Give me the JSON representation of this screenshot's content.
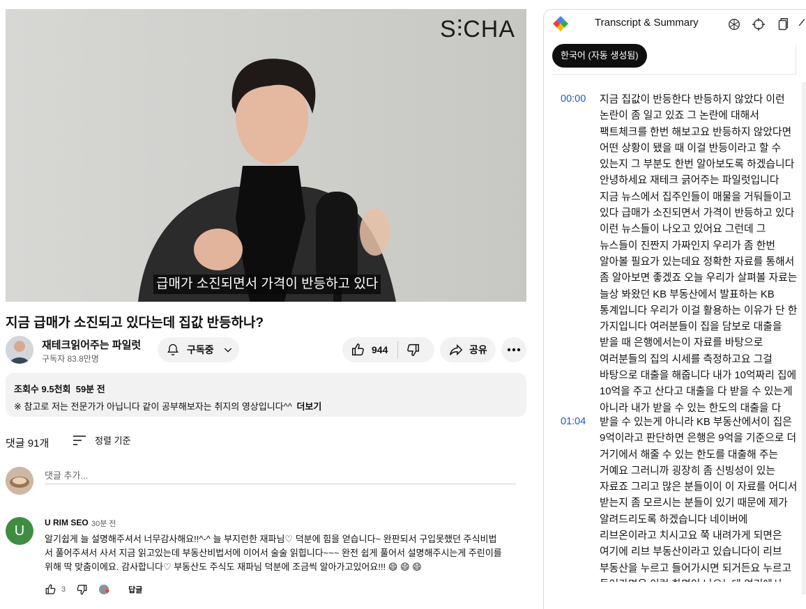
{
  "video": {
    "watermark": "S⫶CHA",
    "caption": "급매가 소진되면서 가격이 반등하고 있다"
  },
  "title": "지금 급매가 소진되고 있다는데 집값 반등하나?",
  "channel": {
    "name": "재테크읽어주는 파일럿",
    "subscribers": "구독자 83.8만명",
    "subscribe_label": "구독중"
  },
  "actions": {
    "likes": "944",
    "share_label": "공유"
  },
  "description": {
    "views": "조회수 9.5천회",
    "age": "59분 전",
    "text": "※ 참고로 저는 전문가가 아닙니다 같이 공부해보자는 취지의 영상입니다^^",
    "more": "더보기"
  },
  "comments": {
    "count_label": "댓글 91개",
    "sort_label": "정렬 기준",
    "add_placeholder": "댓글 추가...",
    "items": [
      {
        "avatar_letter": "U",
        "author": "U RIM SEO",
        "time": "30분 전",
        "text": "알기쉽게 늘 설명해주셔서 너무감사해요!!^-^ 늘 부지런한 재파님♡ 덕분에 힘을 얻습니다~ 완판되서 구입못했던 주식비법서  풀어주셔서 사서 지금 읽고있는데 부동산비법서에 이어서 술술 읽힙니다~~~ 완전 쉽게 풀어서 설명해주시는게 주린이를 위해 딱 맞춤이에요. 감사합니다♡  부동산도 주식도 재파님 덕분에 조금씩 알아가고있어요!!!  😄 😄 😄",
        "likes": "3",
        "reply_label": "답글"
      }
    ]
  },
  "panel": {
    "title": "Transcript & Summary",
    "language_chip": "한국어 (자동 생성됨)",
    "segments": [
      {
        "time": "00:00",
        "text": "지금 집값이 반등한다 반등하지 않았다 이런 논란이 좀 일고 있죠 그 논란에 대해서 팩트체크를 한번 해보고요 반등하지 않았다면 어떤 상황이 됐을 때 이걸 반등이라고 할 수 있는지 그 부분도 한번 알아보도록 하겠습니다 안녕하세요 재테크 긁어주는 파일럿입니다 지금 뉴스에서 집주인들이 매물을 거둬들이고 있다 급매가 소진되면서 가격이 반등하고 있다 이런 뉴스들이 나오고 있어요 그런데 그 뉴스들이 진짠지 가짜인지 우리가 좀 한번 알아볼 필요가 있는데요 정확한 자료를 통해서 좀 알아보면 좋겠죠 오늘 우리가 살펴볼 자료는 늘상 봐왔던 KB 부동산에서 발표하는 KB 통계입니다 우리가 이걸 활용하는 이유가 단 한 가지입니다 여러분들이 집을 담보로 대출을 받을 때 은행에서는이 자료를 바탕으로 여러분들의 집의 시세를 측정하고요 그걸 바탕으로 대출을 해줍니다 내가 10억짜리 집에 10억을 주고 산다고 대출을 다 받을 수 있는게 아니라 내가 받을 수 있는 한도의 대출을 다"
      },
      {
        "time": "01:04",
        "text": "받을 수 있는게 아니라 KB 부동산에서이 집은 9억이라고 판단하면 은행은 9억을 기준으로 더 거기에서 해줄 수 있는 한도를 대출해 주는 거예요 그러니까 굉장히 좀 신빙성이 있는 자료죠 그리고 많은 분들이이 이 자료를 어디서 받는지 좀 모르시는 분들이 있기 때문에 제가 알려드리도록 하겠습니다 네이버에 리브온이라고 치시고요 쭉 내려가게 되면은 여기에 리브 부동산이라고 있습니다이 리브 부동산을 누르고 들어가시면 되거든요 누르고 들어가면은 이런 화면이 나오는데 여기에서 이제 어디를"
      }
    ]
  },
  "colors": {
    "timestamp": "#1a5dc2",
    "chip_bg": "#0f0f0f",
    "pill_bg": "#f2f2f2",
    "comment_avatar": "#3e8e41"
  }
}
